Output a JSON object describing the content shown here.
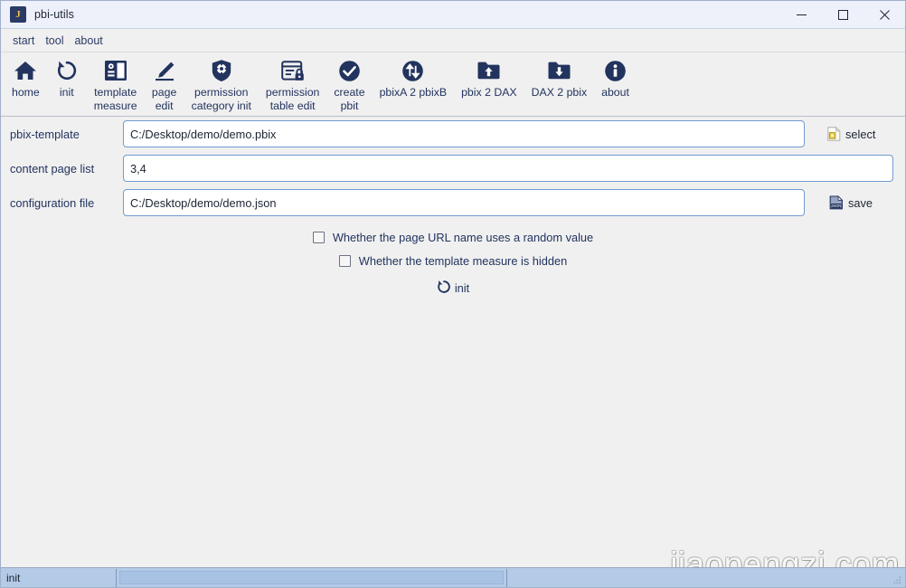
{
  "window": {
    "title": "pbi-utils",
    "icon_letter": "J",
    "controls": {
      "minimize": "minimize-button",
      "maximize": "maximize-button",
      "close": "close-button"
    }
  },
  "menubar": {
    "items": [
      {
        "label": "start"
      },
      {
        "label": "tool"
      },
      {
        "label": "about"
      }
    ]
  },
  "toolbar": {
    "items": [
      {
        "label": "home",
        "icon": "home-icon"
      },
      {
        "label": "init",
        "icon": "rotate-ccw-icon"
      },
      {
        "label": "template\nmeasure",
        "icon": "template-measure-icon"
      },
      {
        "label": "page\nedit",
        "icon": "pencil-edit-icon"
      },
      {
        "label": "permission\ncategory init",
        "icon": "shield-gear-icon"
      },
      {
        "label": "permission\ntable edit",
        "icon": "table-lock-icon"
      },
      {
        "label": "create\npbit",
        "icon": "check-circle-icon"
      },
      {
        "label": "pbixA 2 pbixB",
        "icon": "swap-circle-icon"
      },
      {
        "label": "pbix 2 DAX",
        "icon": "folder-up-icon"
      },
      {
        "label": "DAX 2 pbix",
        "icon": "folder-down-icon"
      },
      {
        "label": "about",
        "icon": "info-circle-icon"
      }
    ]
  },
  "form": {
    "rows": [
      {
        "label": "pbix-template",
        "value": "C:/Desktop/demo/demo.pbix",
        "placeholder": "",
        "action": {
          "label": "select",
          "icon": "file-select-icon"
        }
      },
      {
        "label": "content page list",
        "value": "3,4",
        "placeholder": "",
        "action": null
      },
      {
        "label": "configuration file",
        "value": "C:/Desktop/demo/demo.json",
        "placeholder": "",
        "action": {
          "label": "save",
          "icon": "json-save-icon"
        }
      }
    ],
    "checkboxes": [
      {
        "label": "Whether the page URL name uses a random value",
        "checked": false
      },
      {
        "label": "Whether the template measure is hidden",
        "checked": false
      }
    ],
    "submit": {
      "label": "init",
      "icon": "rotate-ccw-icon"
    }
  },
  "statusbar": {
    "message": "init",
    "progress_value": ""
  },
  "watermark": {
    "text": "jiaopengzi.com"
  },
  "colors": {
    "accent": "#22335e",
    "window_bg": "#f0f0f0",
    "titlebar_bg": "#eef1fa",
    "input_border": "#6f9bd1",
    "status_bg": "#b4cbe8",
    "icon_gold": "#e8c547"
  }
}
